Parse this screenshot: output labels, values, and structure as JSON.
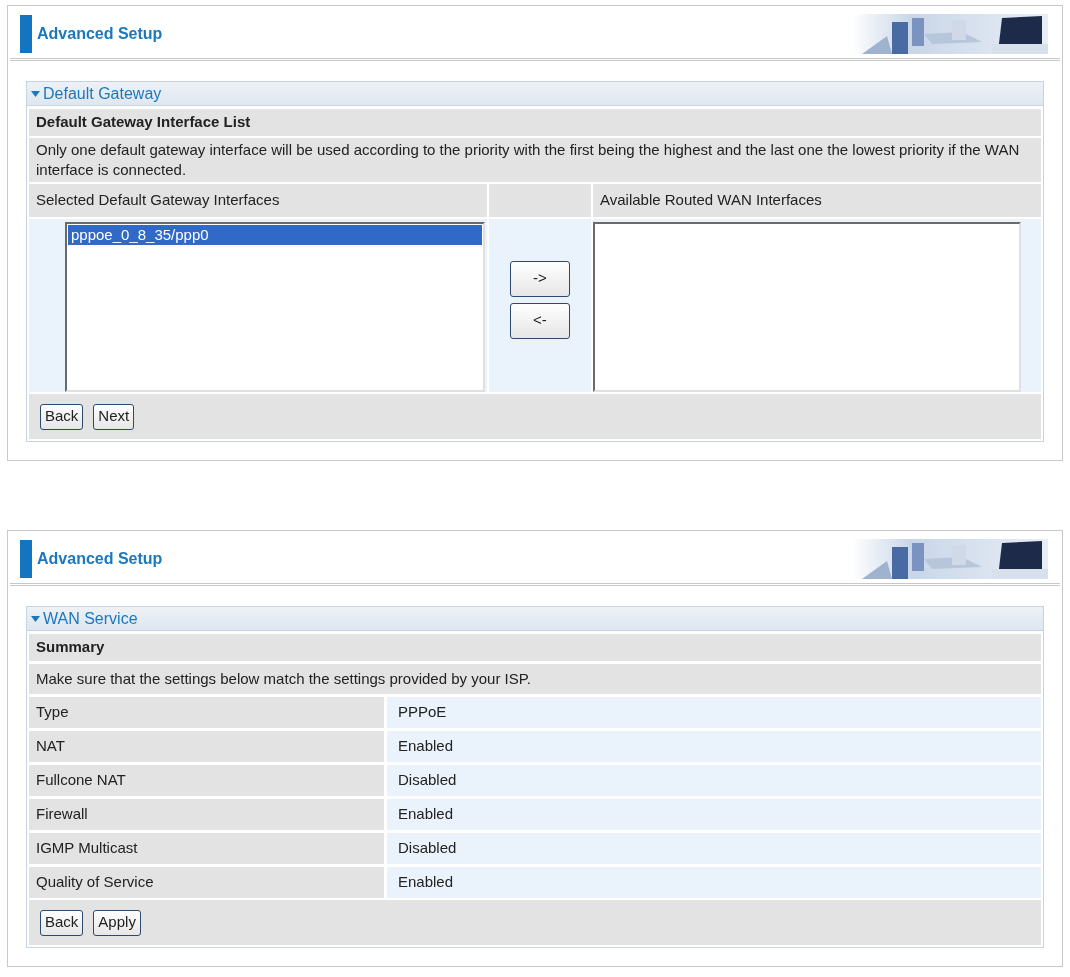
{
  "panels": [
    {
      "kind": "gateway",
      "header": {
        "title": "Advanced Setup"
      },
      "section": {
        "title": "Default Gateway",
        "expanded": true
      },
      "subtitle": "Default Gateway Interface List",
      "description": "Only one default gateway interface will be used according to the priority with the first being the highest and the last one the lowest priority if the WAN interface is connected.",
      "columns": [
        "Selected Default Gateway Interfaces",
        "Available Routed WAN Interfaces"
      ],
      "selected_list": [
        {
          "label": "pppoe_0_8_35/ppp0",
          "selected": true
        }
      ],
      "move_buttons": [
        "->",
        "<-"
      ],
      "buttons": [
        "Back",
        "Next"
      ]
    },
    {
      "kind": "summary",
      "header": {
        "title": "Advanced Setup"
      },
      "section": {
        "title": "WAN Service",
        "expanded": true
      },
      "subtitle": "Summary",
      "description": "Make sure that the settings below match the settings provided by your ISP.",
      "rows": [
        {
          "label": "Type",
          "value": "PPPoE"
        },
        {
          "label": "NAT",
          "value": "Enabled"
        },
        {
          "label": "Fullcone NAT",
          "value": "Disabled"
        },
        {
          "label": "Firewall",
          "value": "Enabled"
        },
        {
          "label": "IGMP Multicast",
          "value": "Disabled"
        },
        {
          "label": "Quality of Service",
          "value": "Enabled"
        }
      ],
      "buttons": [
        "Back",
        "Apply"
      ]
    }
  ]
}
